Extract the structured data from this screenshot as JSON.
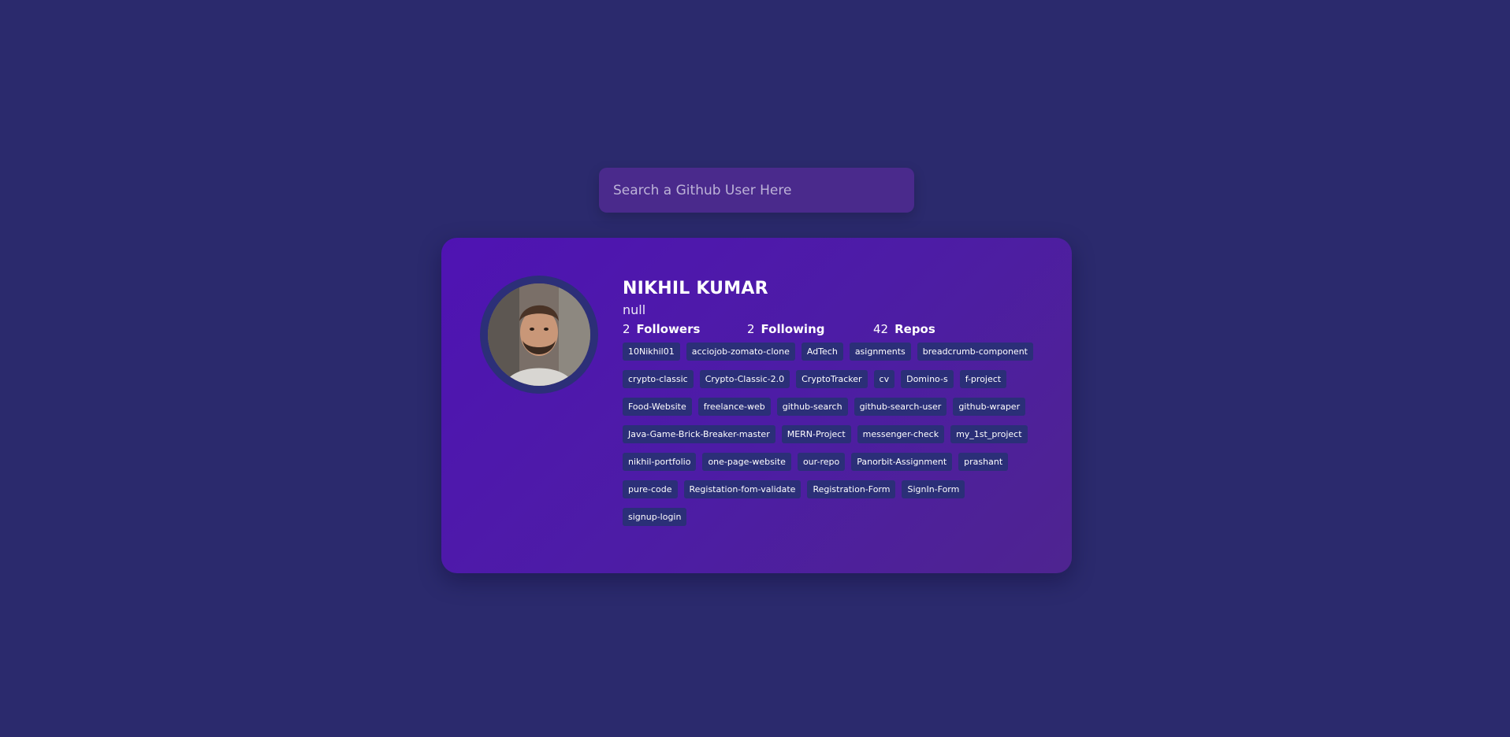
{
  "search": {
    "placeholder": "Search a Github User Here",
    "value": ""
  },
  "profile": {
    "name": "NIKHIL KUMAR",
    "bio": "null",
    "avatar_alt": "profile photo",
    "followers": {
      "count": "2",
      "label": "Followers"
    },
    "following": {
      "count": "2",
      "label": "Following"
    },
    "repos": {
      "count": "42",
      "label": "Repos"
    }
  },
  "repositories": [
    "10Nikhil01",
    "acciojob-zomato-clone",
    "AdTech",
    "asignments",
    "breadcrumb-component",
    "crypto-classic",
    "Crypto-Classic-2.0",
    "CryptoTracker",
    "cv",
    "Domino-s",
    "f-project",
    "Food-Website",
    "freelance-web",
    "github-search",
    "github-search-user",
    "github-wraper",
    "Java-Game-Brick-Breaker-master",
    "MERN-Project",
    "messenger-check",
    "my_1st_project",
    "nikhil-portfolio",
    "one-page-website",
    "our-repo",
    "Panorbit-Assignment",
    "prashant",
    "pure-code",
    "Registation-fom-validate",
    "Registration-Form",
    "SignIn-Form",
    "signup-login"
  ],
  "colors": {
    "background": "#2b2a6d",
    "search_bg": "#4a2a8c",
    "card_gradient_start": "#4f13b3",
    "card_gradient_end": "#4e2490",
    "chip_bg": "#2b2f78",
    "avatar_ring": "#2c2f78"
  }
}
